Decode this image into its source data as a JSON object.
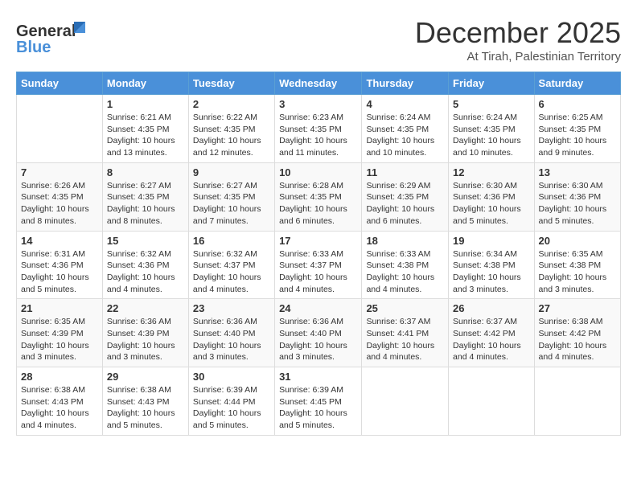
{
  "logo": {
    "general": "General",
    "blue": "Blue"
  },
  "title": "December 2025",
  "location": "At Tirah, Palestinian Territory",
  "headers": [
    "Sunday",
    "Monday",
    "Tuesday",
    "Wednesday",
    "Thursday",
    "Friday",
    "Saturday"
  ],
  "weeks": [
    [
      {
        "day": "",
        "info": ""
      },
      {
        "day": "1",
        "info": "Sunrise: 6:21 AM\nSunset: 4:35 PM\nDaylight: 10 hours\nand 13 minutes."
      },
      {
        "day": "2",
        "info": "Sunrise: 6:22 AM\nSunset: 4:35 PM\nDaylight: 10 hours\nand 12 minutes."
      },
      {
        "day": "3",
        "info": "Sunrise: 6:23 AM\nSunset: 4:35 PM\nDaylight: 10 hours\nand 11 minutes."
      },
      {
        "day": "4",
        "info": "Sunrise: 6:24 AM\nSunset: 4:35 PM\nDaylight: 10 hours\nand 10 minutes."
      },
      {
        "day": "5",
        "info": "Sunrise: 6:24 AM\nSunset: 4:35 PM\nDaylight: 10 hours\nand 10 minutes."
      },
      {
        "day": "6",
        "info": "Sunrise: 6:25 AM\nSunset: 4:35 PM\nDaylight: 10 hours\nand 9 minutes."
      }
    ],
    [
      {
        "day": "7",
        "info": "Sunrise: 6:26 AM\nSunset: 4:35 PM\nDaylight: 10 hours\nand 8 minutes."
      },
      {
        "day": "8",
        "info": "Sunrise: 6:27 AM\nSunset: 4:35 PM\nDaylight: 10 hours\nand 8 minutes."
      },
      {
        "day": "9",
        "info": "Sunrise: 6:27 AM\nSunset: 4:35 PM\nDaylight: 10 hours\nand 7 minutes."
      },
      {
        "day": "10",
        "info": "Sunrise: 6:28 AM\nSunset: 4:35 PM\nDaylight: 10 hours\nand 6 minutes."
      },
      {
        "day": "11",
        "info": "Sunrise: 6:29 AM\nSunset: 4:35 PM\nDaylight: 10 hours\nand 6 minutes."
      },
      {
        "day": "12",
        "info": "Sunrise: 6:30 AM\nSunset: 4:36 PM\nDaylight: 10 hours\nand 5 minutes."
      },
      {
        "day": "13",
        "info": "Sunrise: 6:30 AM\nSunset: 4:36 PM\nDaylight: 10 hours\nand 5 minutes."
      }
    ],
    [
      {
        "day": "14",
        "info": "Sunrise: 6:31 AM\nSunset: 4:36 PM\nDaylight: 10 hours\nand 5 minutes."
      },
      {
        "day": "15",
        "info": "Sunrise: 6:32 AM\nSunset: 4:36 PM\nDaylight: 10 hours\nand 4 minutes."
      },
      {
        "day": "16",
        "info": "Sunrise: 6:32 AM\nSunset: 4:37 PM\nDaylight: 10 hours\nand 4 minutes."
      },
      {
        "day": "17",
        "info": "Sunrise: 6:33 AM\nSunset: 4:37 PM\nDaylight: 10 hours\nand 4 minutes."
      },
      {
        "day": "18",
        "info": "Sunrise: 6:33 AM\nSunset: 4:38 PM\nDaylight: 10 hours\nand 4 minutes."
      },
      {
        "day": "19",
        "info": "Sunrise: 6:34 AM\nSunset: 4:38 PM\nDaylight: 10 hours\nand 3 minutes."
      },
      {
        "day": "20",
        "info": "Sunrise: 6:35 AM\nSunset: 4:38 PM\nDaylight: 10 hours\nand 3 minutes."
      }
    ],
    [
      {
        "day": "21",
        "info": "Sunrise: 6:35 AM\nSunset: 4:39 PM\nDaylight: 10 hours\nand 3 minutes."
      },
      {
        "day": "22",
        "info": "Sunrise: 6:36 AM\nSunset: 4:39 PM\nDaylight: 10 hours\nand 3 minutes."
      },
      {
        "day": "23",
        "info": "Sunrise: 6:36 AM\nSunset: 4:40 PM\nDaylight: 10 hours\nand 3 minutes."
      },
      {
        "day": "24",
        "info": "Sunrise: 6:36 AM\nSunset: 4:40 PM\nDaylight: 10 hours\nand 3 minutes."
      },
      {
        "day": "25",
        "info": "Sunrise: 6:37 AM\nSunset: 4:41 PM\nDaylight: 10 hours\nand 4 minutes."
      },
      {
        "day": "26",
        "info": "Sunrise: 6:37 AM\nSunset: 4:42 PM\nDaylight: 10 hours\nand 4 minutes."
      },
      {
        "day": "27",
        "info": "Sunrise: 6:38 AM\nSunset: 4:42 PM\nDaylight: 10 hours\nand 4 minutes."
      }
    ],
    [
      {
        "day": "28",
        "info": "Sunrise: 6:38 AM\nSunset: 4:43 PM\nDaylight: 10 hours\nand 4 minutes."
      },
      {
        "day": "29",
        "info": "Sunrise: 6:38 AM\nSunset: 4:43 PM\nDaylight: 10 hours\nand 5 minutes."
      },
      {
        "day": "30",
        "info": "Sunrise: 6:39 AM\nSunset: 4:44 PM\nDaylight: 10 hours\nand 5 minutes."
      },
      {
        "day": "31",
        "info": "Sunrise: 6:39 AM\nSunset: 4:45 PM\nDaylight: 10 hours\nand 5 minutes."
      },
      {
        "day": "",
        "info": ""
      },
      {
        "day": "",
        "info": ""
      },
      {
        "day": "",
        "info": ""
      }
    ]
  ]
}
